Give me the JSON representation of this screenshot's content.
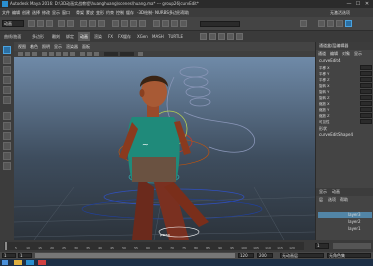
{
  "window": {
    "title": "Autodesk Maya 2016: D:\\3D动画实战教程\\huanghuang\\scenes\\huang.ma* --- group26|curvEdit*",
    "minimize": "—",
    "maximize": "☐",
    "close": "✕"
  },
  "menubar": {
    "items": [
      "文件",
      "编辑",
      "创建",
      "选择",
      "修改",
      "显示",
      "窗口",
      "骨架",
      "蒙皮",
      "变形",
      "约束",
      "控制",
      "缓存",
      "-3D绘制-",
      "NURBS",
      "多边形",
      "帮助"
    ],
    "workspace": "无激活选项"
  },
  "shelf": {
    "menu_set": "动画",
    "tabs": [
      "曲线/曲面",
      "多边形",
      "雕刻",
      "绑定",
      "动画",
      "渲染",
      "FX",
      "FX缓存",
      "XGen",
      "MASH",
      "TURTLE"
    ]
  },
  "viewport": {
    "menu": [
      "视图",
      "着色",
      "照明",
      "显示",
      "渲染器",
      "面板"
    ],
    "camera_label": "persp"
  },
  "channel_box": {
    "header": "通道盒/层编辑器",
    "tabs": [
      "通道",
      "编辑",
      "对象",
      "显示"
    ],
    "object_name": "curveEdit4",
    "shapes_label": "形状",
    "shape_name": "curveEditShape4",
    "attributes": [
      "平移 X",
      "平移 Y",
      "平移 Z",
      "旋转 X",
      "旋转 Y",
      "旋转 Z",
      "缩放 X",
      "缩放 Y",
      "缩放 Z",
      "可见性"
    ]
  },
  "layers": {
    "tabs": [
      "显示",
      "动画"
    ],
    "menu": [
      "层",
      "选项",
      "帮助"
    ],
    "items": [
      {
        "label": "layer3",
        "selected": true
      },
      {
        "label": "layer2",
        "selected": false
      },
      {
        "label": "layer1",
        "selected": false
      }
    ]
  },
  "timeline": {
    "current_frame": "1",
    "tick_labels": [
      "5",
      "10",
      "15",
      "20",
      "25",
      "30",
      "35",
      "40",
      "45",
      "50",
      "55",
      "60",
      "65",
      "70",
      "75",
      "80",
      "85",
      "90",
      "95",
      "100",
      "105",
      "110",
      "115",
      "120"
    ]
  },
  "range": {
    "start": "1",
    "inner_start": "1",
    "inner_end": "120",
    "end": "200",
    "anim_layer": "无动画层",
    "char_set": "无角色集"
  },
  "colors": {
    "accent": "#5285a6",
    "active_tool": "#2b6fa3",
    "red": "#c0392b"
  }
}
